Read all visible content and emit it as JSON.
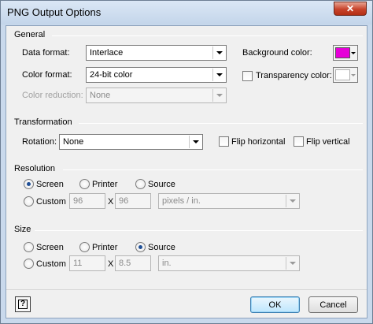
{
  "window": {
    "title": "PNG Output Options",
    "close_glyph": "✕"
  },
  "general": {
    "label": "General",
    "data_format": {
      "label": "Data format:",
      "value": "Interlace"
    },
    "color_format": {
      "label": "Color format:",
      "value": "24-bit color"
    },
    "color_reduction": {
      "label": "Color reduction:",
      "value": "None"
    },
    "background_color": {
      "label": "Background color:",
      "color": "#e600d8"
    },
    "transparency_color": {
      "label": "Transparency color:",
      "checked": false,
      "color": "#ffffff"
    }
  },
  "transformation": {
    "label": "Transformation",
    "rotation": {
      "label": "Rotation:",
      "value": "None"
    },
    "flip_horizontal": {
      "label": "Flip horizontal",
      "checked": false
    },
    "flip_vertical": {
      "label": "Flip vertical",
      "checked": false
    }
  },
  "resolution": {
    "label": "Resolution",
    "options": {
      "screen": "Screen",
      "printer": "Printer",
      "source": "Source",
      "custom": "Custom"
    },
    "selected": "screen",
    "custom_x": "96",
    "x_sep": "X",
    "custom_y": "96",
    "unit": "pixels / in."
  },
  "size": {
    "label": "Size",
    "options": {
      "screen": "Screen",
      "printer": "Printer",
      "source": "Source",
      "custom": "Custom"
    },
    "selected": "source",
    "custom_x": "11",
    "x_sep": "X",
    "custom_y": "8.5",
    "unit": "in."
  },
  "buttons": {
    "help": "?",
    "ok": "OK",
    "cancel": "Cancel"
  }
}
